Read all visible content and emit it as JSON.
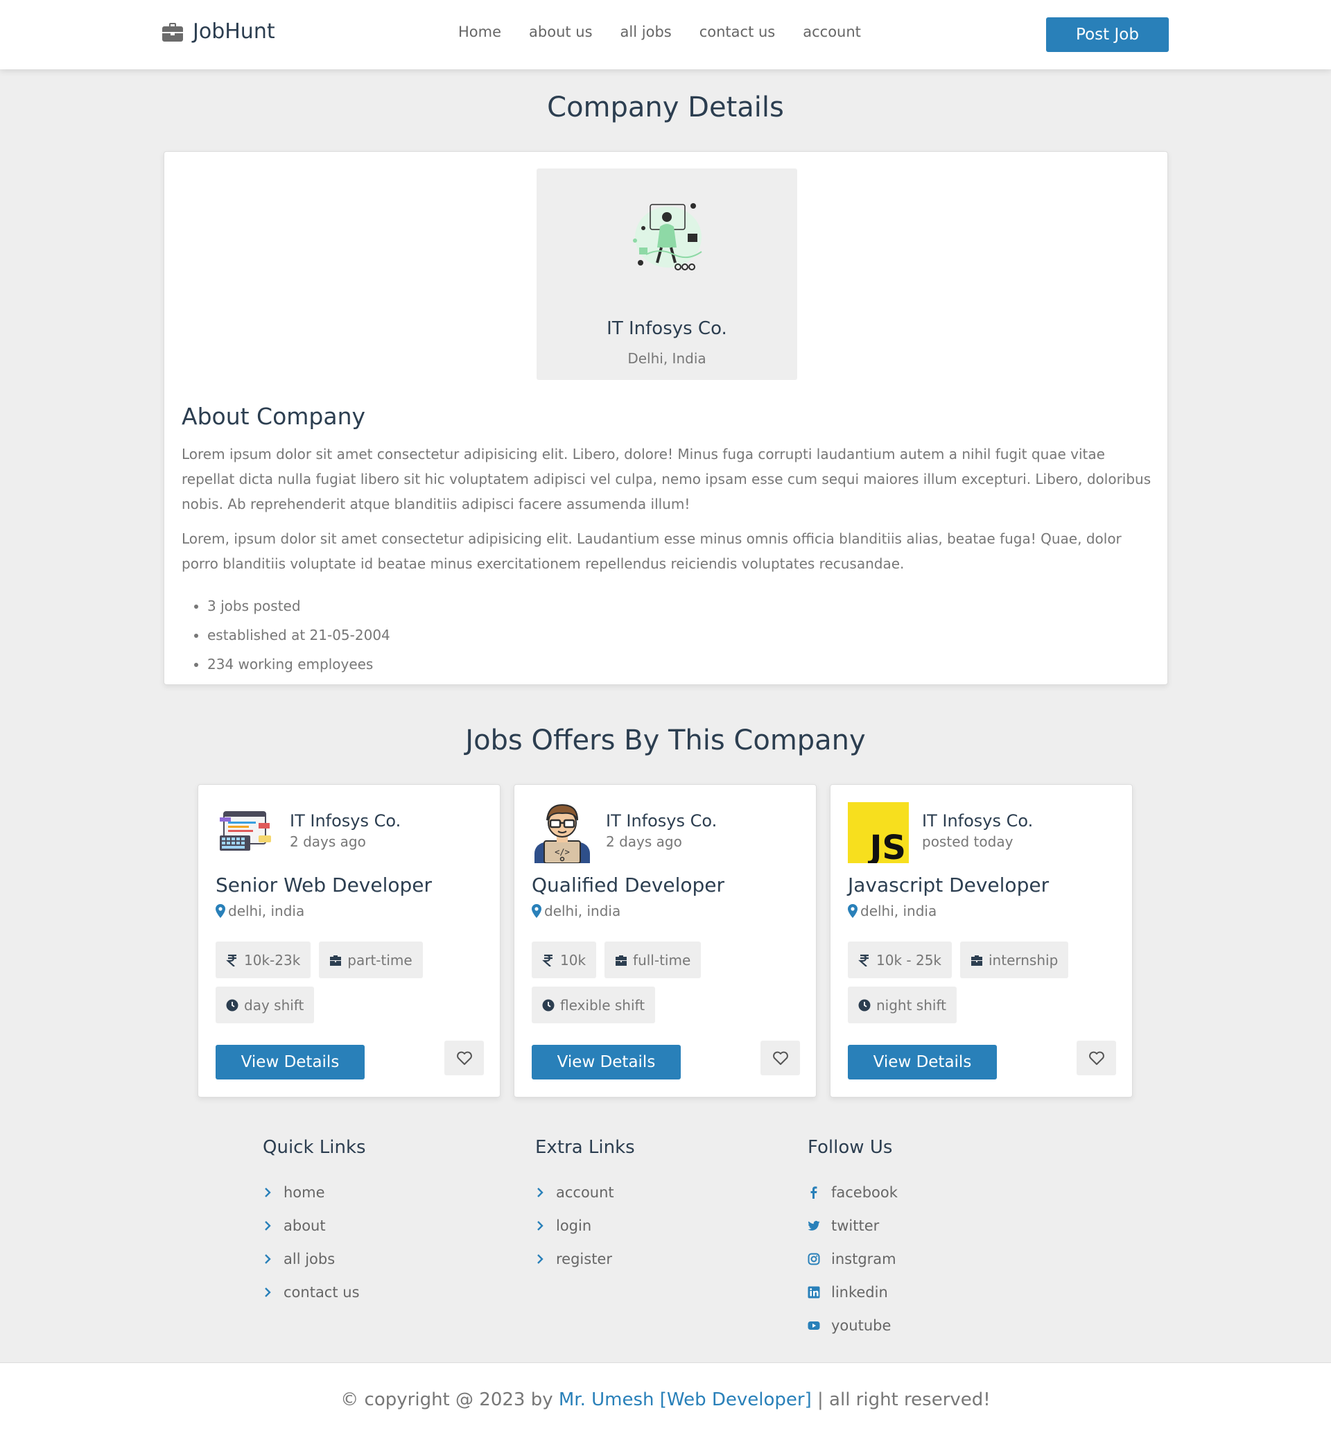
{
  "header": {
    "logo_text": "JobHunt",
    "nav": [
      "Home",
      "about us",
      "all jobs",
      "contact us",
      "account"
    ],
    "post_button": "Post Job"
  },
  "page_title": "Company Details",
  "company": {
    "name": "IT Infosys Co.",
    "location": "Delhi, India",
    "about_title": "About Company",
    "paragraphs": [
      "Lorem ipsum dolor sit amet consectetur adipisicing elit. Libero, dolore! Minus fuga corrupti laudantium autem a nihil fugit quae vitae repellat dicta nulla fugiat libero sit hic voluptatem adipisci vel culpa, nemo ipsam esse cum sequi maiores illum excepturi. Libero, doloribus nobis. Ab reprehenderit atque blanditiis adipisci facere assumenda illum!",
      "Lorem, ipsum dolor sit amet consectetur adipisicing elit. Laudantium esse minus omnis officia blanditiis alias, beatae fuga! Quae, dolor porro blanditiis voluptate id beatae minus exercitationem repellendus reiciendis voluptates recusandae."
    ],
    "facts": [
      "3 jobs posted",
      "established at 21-05-2004",
      "234 working employees"
    ]
  },
  "jobs_title": "Jobs Offers By This Company",
  "jobs": [
    {
      "company": "IT Infosys Co.",
      "posted": "2 days ago",
      "title": "Senior Web Developer",
      "location": "delhi, india",
      "salary": "10k-23k",
      "type": "part-time",
      "shift": "day shift",
      "view_label": "View Details",
      "logo_icon": "web-dev-icon"
    },
    {
      "company": "IT Infosys Co.",
      "posted": "2 days ago",
      "title": "Qualified Developer",
      "location": "delhi, india",
      "salary": "10k",
      "type": "full-time",
      "shift": "flexible shift",
      "view_label": "View Details",
      "logo_icon": "developer-avatar-icon"
    },
    {
      "company": "IT Infosys Co.",
      "posted": "posted today",
      "title": "Javascript Developer",
      "location": "delhi, india",
      "salary": "10k - 25k",
      "type": "internship",
      "shift": "night shift",
      "view_label": "View Details",
      "logo_icon": "javascript-icon"
    }
  ],
  "footer": {
    "quick": {
      "title": "Quick Links",
      "links": [
        "home",
        "about",
        "all jobs",
        "contact us"
      ]
    },
    "extra": {
      "title": "Extra Links",
      "links": [
        "account",
        "login",
        "register"
      ]
    },
    "follow": {
      "title": "Follow Us",
      "links": [
        "facebook",
        "twitter",
        "instgram",
        "linkedin",
        "youtube"
      ]
    },
    "copyright_prefix": "© copyright @ 2023 by",
    "copyright_author": "Mr. Umesh [Web Developer]",
    "copyright_suffix": "| all right reserved!"
  },
  "colors": {
    "accent": "#2980b9",
    "heading": "#2c3e50",
    "muted": "#777777",
    "background": "#eeeeee"
  }
}
